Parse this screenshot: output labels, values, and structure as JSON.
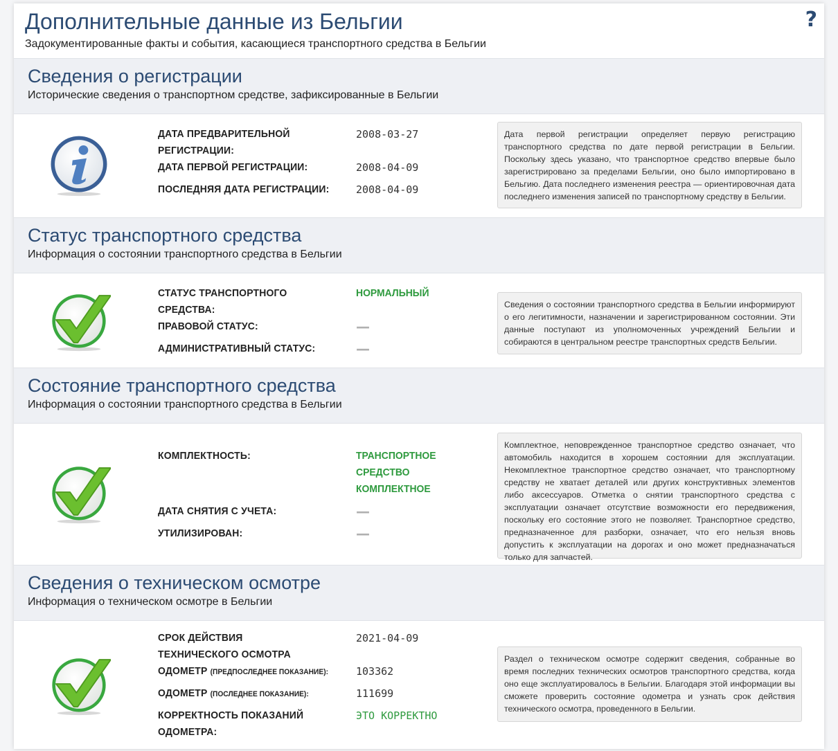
{
  "header": {
    "title": "Дополнительные данные из Бельгии",
    "subtitle": "Задокументированные факты и события, касающиеся транспортного средства в Бельгии",
    "help_glyph": "?"
  },
  "sections": [
    {
      "title": "Сведения о регистрации",
      "subtitle": "Исторические сведения о транспортном средстве, зафиксированные в Бельгии",
      "icon": "info-icon",
      "rows": [
        {
          "label": "Дата предварительной регистрации:",
          "value": "2008-03-27"
        },
        {
          "label": "Дата первой регистрации:",
          "value": "2008-04-09"
        },
        {
          "label": "Последняя дата регистрации:",
          "value": "2008-04-09"
        }
      ],
      "note": "Дата первой регистрации определяет первую регистрацию транспортного средства по дате первой регистрации в Бельгии. Поскольку здесь указано, что транспортное средство впервые было зарегистрировано за пределами Бельгии, оно было импортировано в Бельгию. Дата последнего изменения реестра — ориентировочная дата последнего изменения записей по транспортному средству в Бельгии."
    },
    {
      "title": "Статус транспортного средства",
      "subtitle": "Информация о состоянии транспортного средства в Бельгии",
      "icon": "checkmark-icon",
      "rows": [
        {
          "label": "Статус транспортного средства:",
          "value": "Нормальный"
        },
        {
          "label": "Правовой статус:",
          "value": "—"
        },
        {
          "label": "Административный статус:",
          "value": "—"
        }
      ],
      "note": "Сведения о состоянии транспортного средства в Бельгии информируют о его легитимности, назначении и зарегистрированном состоянии. Эти данные поступают из уполномоченных учреждений Бельгии и собираются в центральном реестре транспортных средств Бельгии."
    },
    {
      "title": "Состояние транспортного средства",
      "subtitle": "Информация о состоянии транспортного средства в Бельгии",
      "icon": "checkmark-icon",
      "rows": [
        {
          "label": "Комплектность:",
          "value": "Транспортное средство комплектное"
        },
        {
          "label": "Дата снятия с учета:",
          "value": "—"
        },
        {
          "label": "Утилизирован:",
          "value": "—"
        }
      ],
      "note": "Комплектное, неповрежденное транспортное средство означает, что автомобиль находится в хорошем состоянии для эксплуатации. Некомплектное транспортное средство означает, что транспортному средству не хватает деталей или других конструктивных элементов либо аксессуаров. Отметка о снятии транспортного средства с эксплуатации означает отсутствие возможности его передвижения, поскольку его состояние этого не позволяет. Транспортное средство, предназначенное для разборки, означает, что его нельзя вновь допустить к эксплуатации на дорогах и оно может предназначаться только для запчастей."
    },
    {
      "title": "Сведения о техническом осмотре",
      "subtitle": "Информация о техническом осмотре в Бельгии",
      "icon": "checkmark-icon",
      "rows": [
        {
          "label": "Срок действия технического осмотра",
          "value": "2021-04-09"
        },
        {
          "label": "Одометр",
          "label_note": "(предпоследнее показание):",
          "value": "103362"
        },
        {
          "label": "Одометр",
          "label_note": "(последнее показание):",
          "value": "111699"
        },
        {
          "label": "Корректность показаний одометра:",
          "value": "ЭТО КОРРЕКТНО"
        }
      ],
      "note": "Раздел о техническом осмотре содержит сведения, собранные во время последних технических осмотров транспортного средства, когда оно еще эксплуатировалось в Бельгии. Благодаря этой информации вы сможете проверить состояние одометра и узнать срок действия технического осмотра, проведенного в Бельгии."
    }
  ]
}
